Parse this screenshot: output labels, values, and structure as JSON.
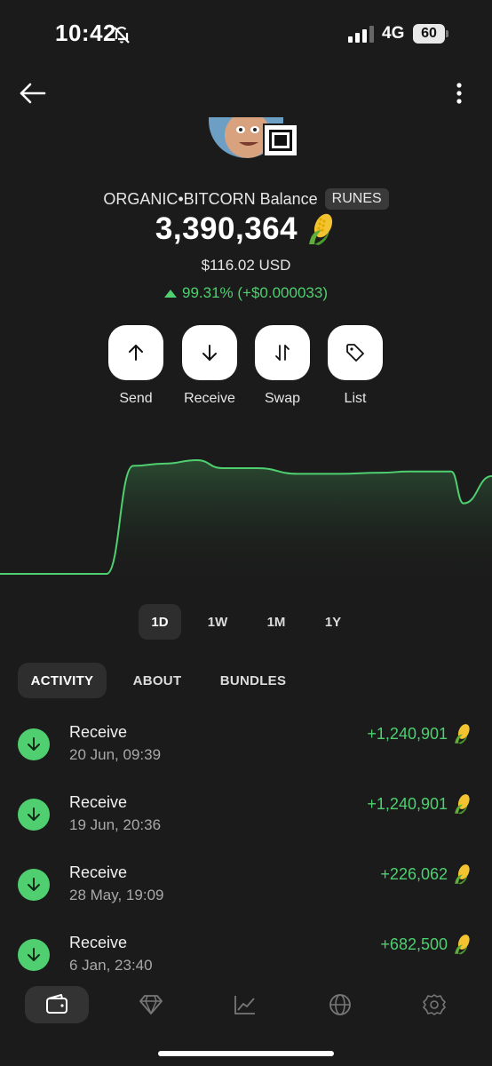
{
  "status_bar": {
    "time": "10:42",
    "network": "4G",
    "battery": "60"
  },
  "header": {
    "back_icon": "arrow-left-icon",
    "more_icon": "more-vertical-icon"
  },
  "token": {
    "balance_label": "ORGANIC•BITCORN Balance",
    "tag": "RUNES",
    "balance": "3,390,364",
    "emoji": "corn-icon",
    "usd": "$116.02 USD",
    "change": "99.31% (+$0.000033)"
  },
  "actions": [
    {
      "label": "Send",
      "icon": "arrow-up-icon"
    },
    {
      "label": "Receive",
      "icon": "arrow-down-icon"
    },
    {
      "label": "Swap",
      "icon": "swap-icon"
    },
    {
      "label": "List",
      "icon": "tag-icon"
    }
  ],
  "chart_data": {
    "type": "area",
    "x": [
      0,
      1,
      2,
      3,
      4,
      5,
      6,
      7,
      8,
      9,
      10,
      11,
      12,
      13,
      14,
      15,
      16,
      17
    ],
    "series": [
      {
        "values": [
          0,
          0,
          0,
          0,
          0,
          0.95,
          0.97,
          1.0,
          0.93,
          0.93,
          0.88,
          0.88,
          0.89,
          0.9,
          0.9,
          0.9,
          0.62,
          0.86
        ]
      }
    ],
    "grid": false,
    "color": "#4fcf70"
  },
  "ranges": [
    "1D",
    "1W",
    "1M",
    "1Y"
  ],
  "tabs": [
    "ACTIVITY",
    "ABOUT",
    "BUNDLES"
  ],
  "activity": [
    {
      "title": "Receive",
      "date": "20 Jun, 09:39",
      "amount": "+1,240,901"
    },
    {
      "title": "Receive",
      "date": "19 Jun, 20:36",
      "amount": "+1,240,901"
    },
    {
      "title": "Receive",
      "date": "28 May, 19:09",
      "amount": "+226,062"
    },
    {
      "title": "Receive",
      "date": "6 Jan, 23:40",
      "amount": "+682,500"
    }
  ],
  "bottom_nav": [
    "wallet-icon",
    "diamond-icon",
    "chart-icon",
    "globe-icon",
    "settings-icon"
  ],
  "colors": {
    "positive": "#4fcf70",
    "background": "#1b1b1b"
  }
}
